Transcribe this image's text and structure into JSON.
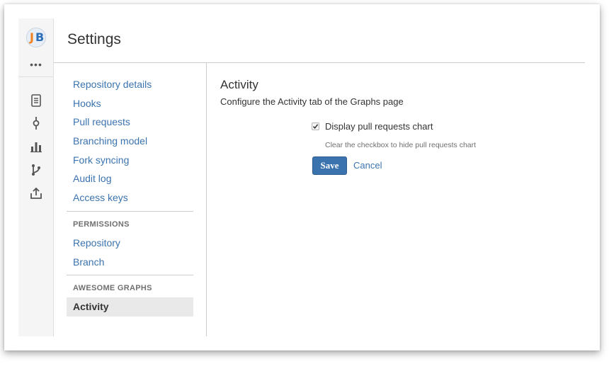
{
  "header": {
    "title": "Settings"
  },
  "avatar": {
    "letter_1": "J",
    "letter_2": "B"
  },
  "rail": {
    "more": "•••",
    "icons": [
      "source-icon",
      "commits-icon",
      "graphs-icon",
      "branches-icon",
      "fork-icon"
    ]
  },
  "nav": {
    "general": [
      "Repository details",
      "Hooks",
      "Pull requests",
      "Branching model",
      "Fork syncing",
      "Audit log",
      "Access keys"
    ],
    "permissions_heading": "PERMISSIONS",
    "permissions": [
      "Repository",
      "Branch"
    ],
    "awesome_heading": "AWESOME GRAPHS",
    "awesome": [
      "Activity"
    ]
  },
  "content": {
    "title": "Activity",
    "description": "Configure the Activity tab of the Graphs page",
    "checkbox_label": "Display pull requests chart",
    "checkbox_checked": true,
    "checkbox_help": "Clear the checkbox to hide pull requests chart",
    "save_label": "Save",
    "cancel_label": "Cancel"
  },
  "colors": {
    "link": "#3b73af",
    "primary_button": "#3b73af",
    "active_nav_bg": "#e9e9e9"
  }
}
